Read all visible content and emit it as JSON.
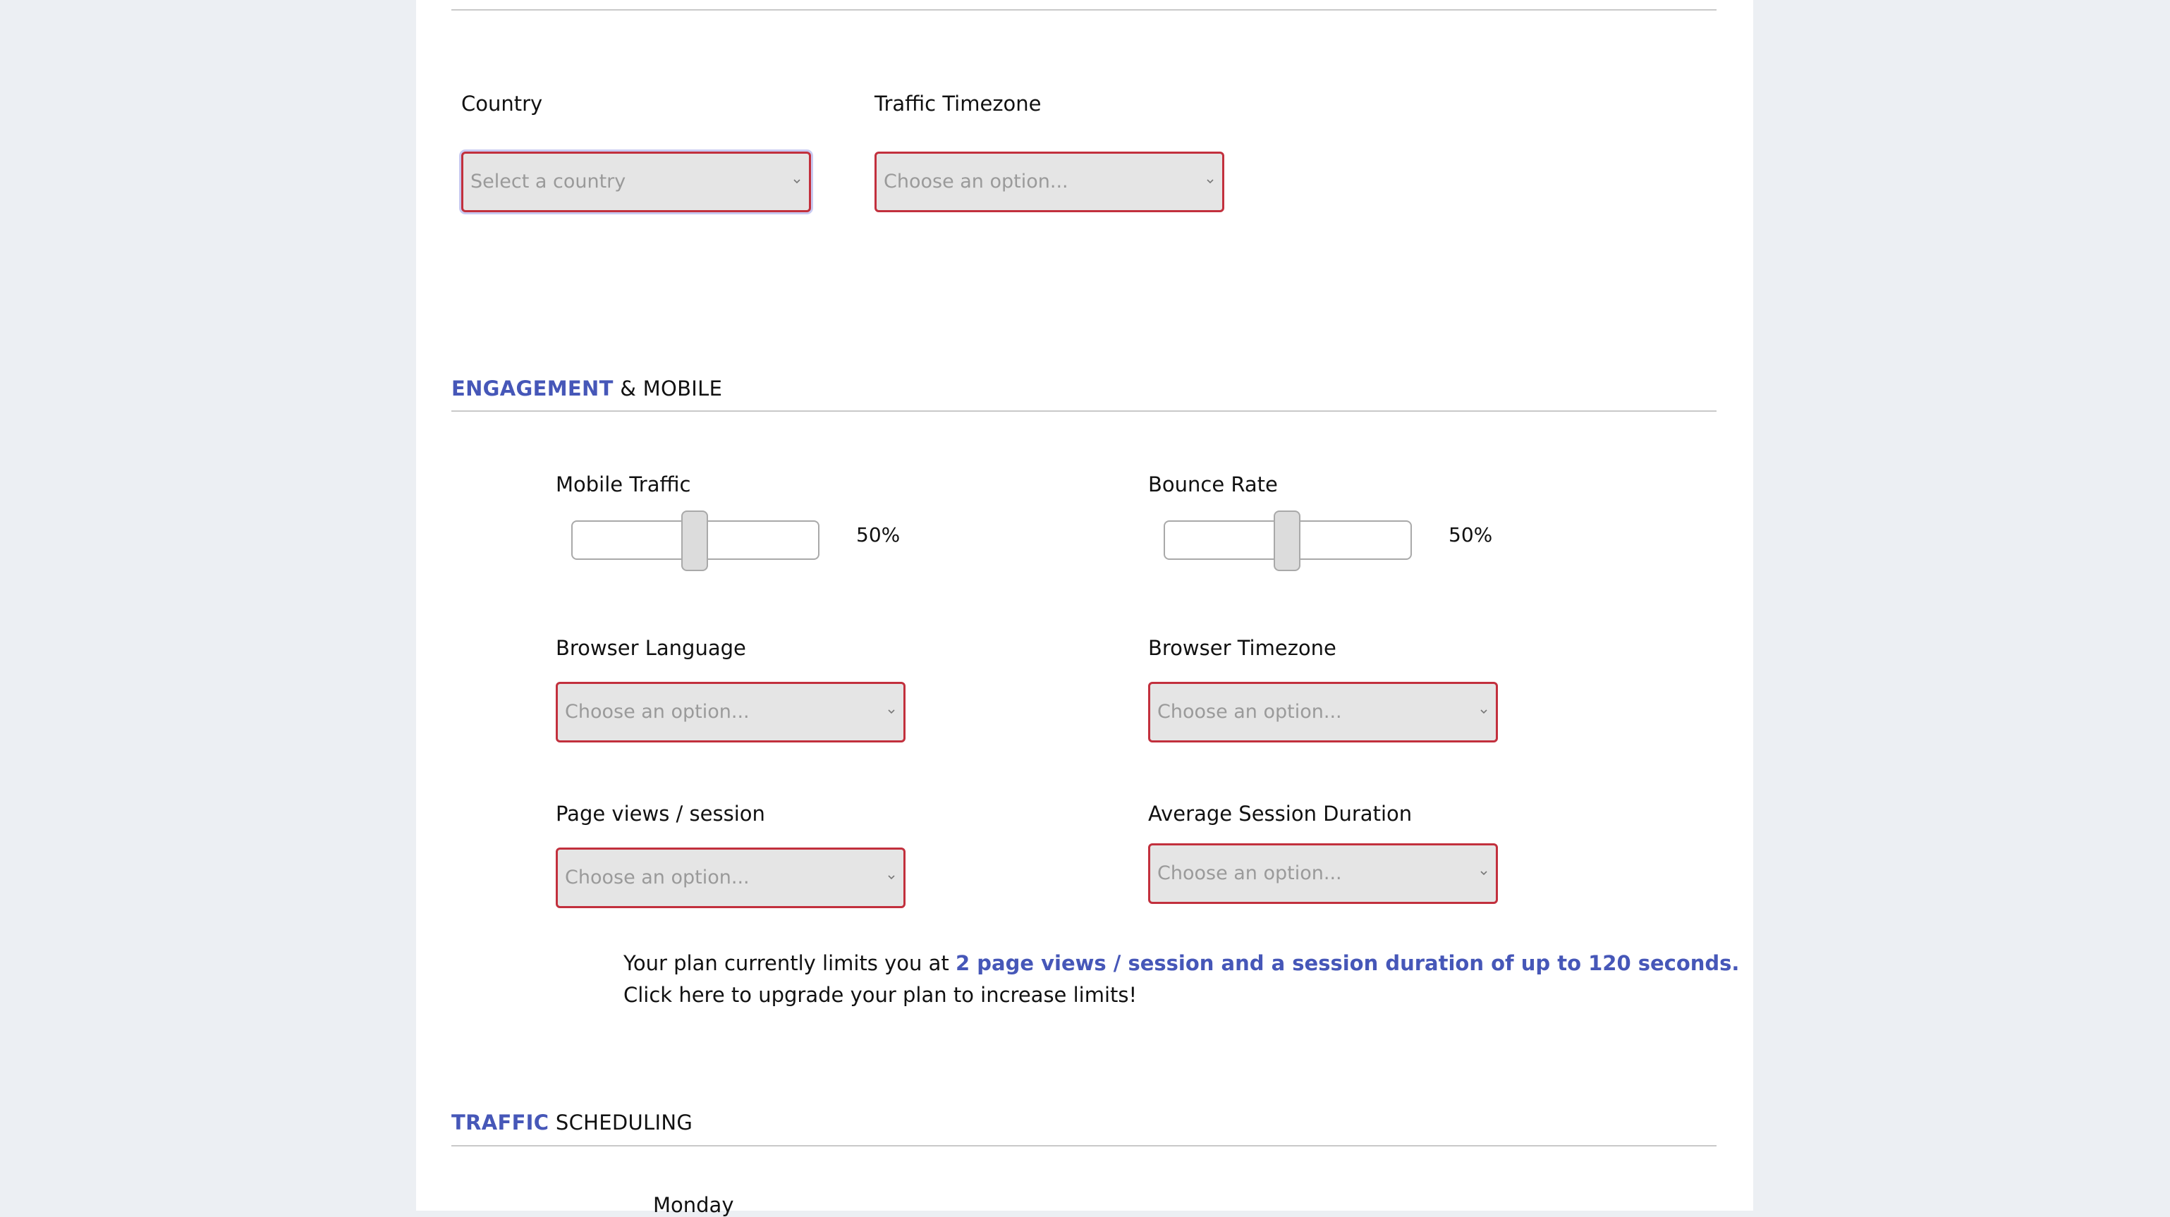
{
  "location": {
    "country": {
      "label": "Country",
      "placeholder": "Select a country"
    },
    "traffic_timezone": {
      "label": "Traffic Timezone",
      "placeholder": "Choose an option..."
    }
  },
  "engagement": {
    "title_accent": "ENGAGEMENT",
    "title_rest": "& MOBILE",
    "mobile_traffic": {
      "label": "Mobile Traffic",
      "value_text": "50%",
      "value": 0.5
    },
    "bounce_rate": {
      "label": "Bounce Rate",
      "value_text": "50%",
      "value": 0.5
    },
    "browser_language": {
      "label": "Browser Language",
      "placeholder": "Choose an option..."
    },
    "browser_timezone": {
      "label": "Browser Timezone",
      "placeholder": "Choose an option..."
    },
    "page_views": {
      "label": "Page views / session",
      "placeholder": "Choose an option..."
    },
    "session_duration": {
      "label": "Average Session Duration",
      "placeholder": "Choose an option..."
    },
    "plan_note": {
      "prefix": "Your plan currently limits you at ",
      "highlight": "2 page views / session and a session duration of up to 120 seconds.",
      "upgrade": "Click here to upgrade your plan to increase limits!"
    }
  },
  "scheduling": {
    "title_accent": "TRAFFIC",
    "title_rest": "SCHEDULING",
    "first_day": "Monday"
  },
  "colors": {
    "accent": "#4657b8",
    "error_border": "#c2303d",
    "field_bg": "#e5e5e5",
    "page_bg": "#eceff3"
  },
  "icons": {
    "select_arrow": "chevron-down-icon"
  }
}
